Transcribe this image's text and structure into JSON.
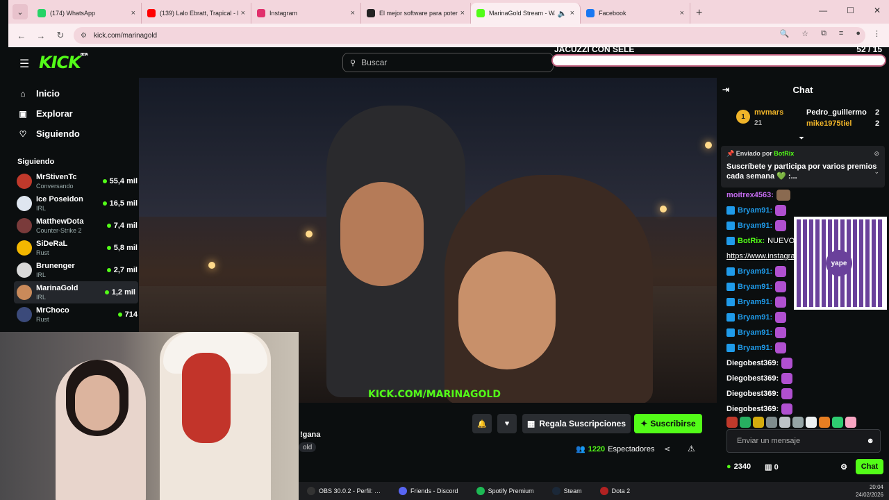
{
  "browser": {
    "tabs": [
      {
        "title": "(174) WhatsApp",
        "color": "#25d366"
      },
      {
        "title": "(139) Lalo Ebratt, Trapical - Mo…",
        "color": "#ff0000"
      },
      {
        "title": "Instagram",
        "color": "#e1306c"
      },
      {
        "title": "El mejor software para potenci…",
        "color": "#222222"
      },
      {
        "title": "MarinaGold Stream - Watch…",
        "color": "#53fc18",
        "active": true
      },
      {
        "title": "Facebook",
        "color": "#1877f2"
      }
    ],
    "url": "kick.com/marinagold"
  },
  "topbar": {
    "logo": "KICK",
    "logo_beta": "BETA",
    "search_placeholder": "Buscar"
  },
  "goal": {
    "title": "JACUZZI CON SELE",
    "count": "52  / 15",
    "progress": 1.0
  },
  "sidebar": {
    "nav": [
      {
        "label": "Inicio",
        "icon": "home-icon"
      },
      {
        "label": "Explorar",
        "icon": "compass-icon"
      },
      {
        "label": "Siguiendo",
        "icon": "heart-icon"
      }
    ],
    "heading": "Siguiendo",
    "channels": [
      {
        "name": "MrStivenTc",
        "category": "Conversando",
        "viewers": "55,4 mil",
        "color": "#c0392b"
      },
      {
        "name": "Ice Poseidon",
        "category": "IRL",
        "viewers": "16,5 mil",
        "color": "#dfe6f0"
      },
      {
        "name": "MatthewDota",
        "category": "Counter-Strike 2",
        "viewers": "7,4 mil",
        "color": "#7a3b3b"
      },
      {
        "name": "SiDeRaL",
        "category": "Rust",
        "viewers": "5,8 mil",
        "color": "#f3b700"
      },
      {
        "name": "Brunenger",
        "category": "IRL",
        "viewers": "2,7 mil",
        "color": "#d9d9d9"
      },
      {
        "name": "MarinaGold",
        "category": "IRL",
        "viewers": "1,2 mil",
        "color": "#c98a5a",
        "selected": true
      },
      {
        "name": "MrChoco",
        "category": "Rust",
        "viewers": "714",
        "color": "#3b4a7a"
      }
    ]
  },
  "video": {
    "watermark": "KICK.COM/MARINAGOLD"
  },
  "stream": {
    "title_fragment": "!gana",
    "category_fragment": "old",
    "gift_label": "Regala Suscripciones",
    "subscribe_label": "Suscribirse",
    "viewers": "1220",
    "viewers_label": "Espectadores"
  },
  "taskbar": [
    {
      "label": "OBS 30.0.2 - Perfil: …",
      "color": "#333"
    },
    {
      "label": "Friends - Discord",
      "color": "#5865f2"
    },
    {
      "label": "Spotify Premium",
      "color": "#1db954"
    },
    {
      "label": "Steam",
      "color": "#1b2838"
    },
    {
      "label": "Dota 2",
      "color": "#b22222"
    }
  ],
  "clock": {
    "time": "20:04",
    "date": "24/02/2026"
  },
  "chat": {
    "title": "Chat",
    "top_gifters": [
      {
        "rank": "1",
        "name": "mvmars",
        "count": "21"
      },
      {
        "name": "Pedro_guillermo",
        "count": "2"
      },
      {
        "name": "mike1975tiel",
        "count": "2"
      }
    ],
    "pinned": {
      "sent_by": "Enviado por",
      "bot": "BotRix",
      "message": "Suscríbete y participa por varios premios cada semana 💚 :..."
    },
    "messages": [
      {
        "user": "moitrex4563:",
        "color": "#c56cf0",
        "text": ""
      },
      {
        "user": "Bryam91:",
        "color": "#1f9bea",
        "text": ""
      },
      {
        "user": "Bryam91:",
        "color": "#1f9bea",
        "text": ""
      },
      {
        "user": "BotRix:",
        "color": "#53fc18",
        "text": "NUEVO"
      },
      {
        "user": "https://www.instagra",
        "color": "#ffffff",
        "text": ""
      },
      {
        "user": "Bryam91:",
        "color": "#1f9bea",
        "text": ""
      },
      {
        "user": "Bryam91:",
        "color": "#1f9bea",
        "text": ""
      },
      {
        "user": "Bryam91:",
        "color": "#1f9bea",
        "text": ""
      },
      {
        "user": "Bryam91:",
        "color": "#1f9bea",
        "text": ""
      },
      {
        "user": "Bryam91:",
        "color": "#1f9bea",
        "text": ""
      },
      {
        "user": "Bryam91:",
        "color": "#1f9bea",
        "text": ""
      },
      {
        "user": "Diegobest369:",
        "color": "#ffffff",
        "text": ""
      },
      {
        "user": "Diegobest369:",
        "color": "#ffffff",
        "text": ""
      },
      {
        "user": "Diegobest369:",
        "color": "#ffffff",
        "text": ""
      },
      {
        "user": "Diegobest369:",
        "color": "#ffffff",
        "text": ""
      }
    ],
    "qr_logo": "yape",
    "input_placeholder": "Enviar un mensaje",
    "points": "2340",
    "gifts": "0",
    "chat_button": "Chat"
  }
}
